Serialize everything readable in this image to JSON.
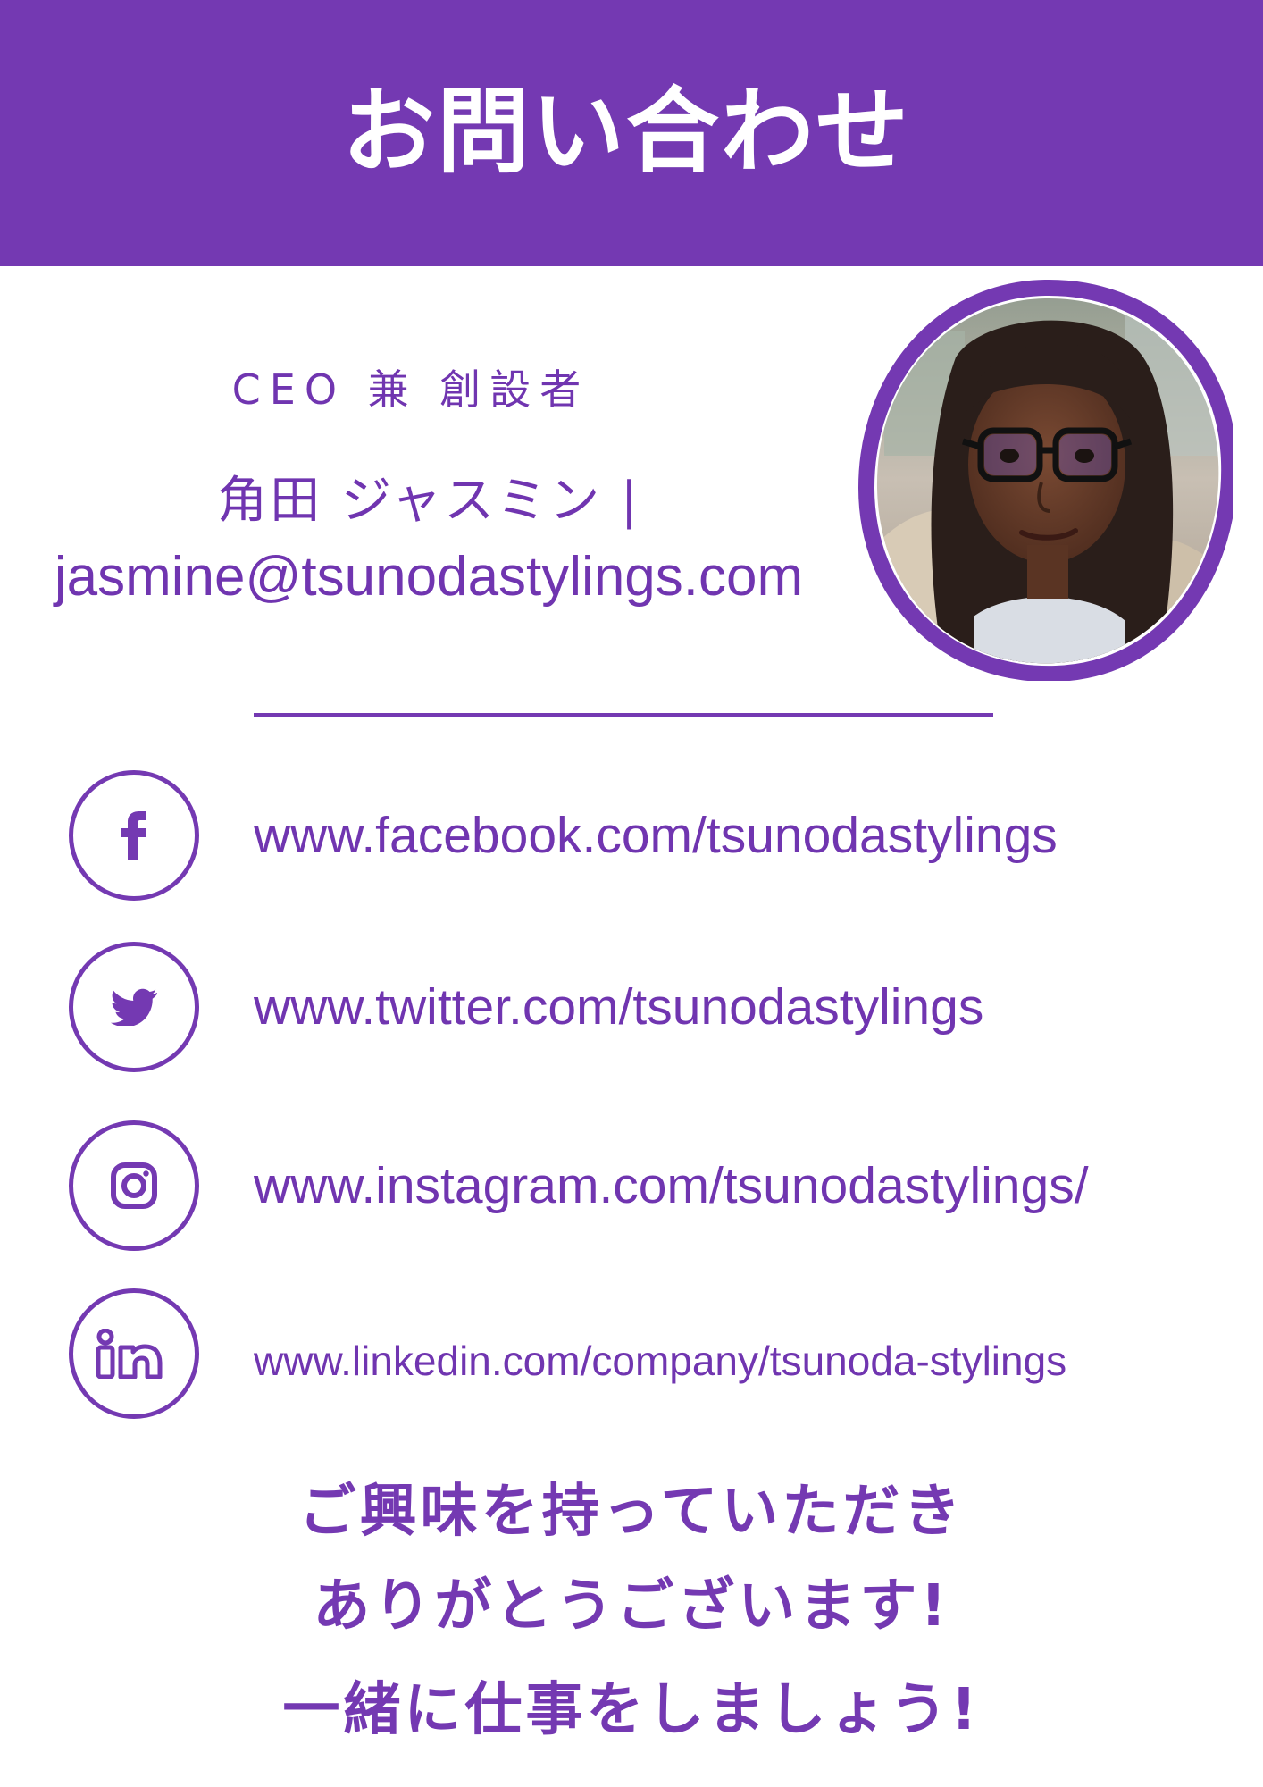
{
  "header": {
    "title": "お問い合わせ"
  },
  "profile": {
    "role": "CEO 兼 創設者",
    "name": "角田 ジャスミン |",
    "email": "jasmine@tsunodastylings.com",
    "photo_alt": "portrait-photo"
  },
  "social": {
    "facebook": {
      "url": "www.facebook.com/tsunodastylings",
      "icon": "facebook-icon"
    },
    "twitter": {
      "url": "www.twitter.com/tsunodastylings",
      "icon": "twitter-icon"
    },
    "instagram": {
      "url": "www.instagram.com/tsunodastylings/",
      "icon": "instagram-icon"
    },
    "linkedin": {
      "url": "www.linkedin.com/company/tsunoda-stylings",
      "icon": "linkedin-icon"
    }
  },
  "closing": {
    "line1": "ご興味を持っていただき",
    "line2": "ありがとうございます!",
    "line3": "一緒に仕事をしましょう!"
  },
  "colors": {
    "brand": "#7439b2",
    "text": "#7035b0",
    "background": "#ffffff"
  }
}
